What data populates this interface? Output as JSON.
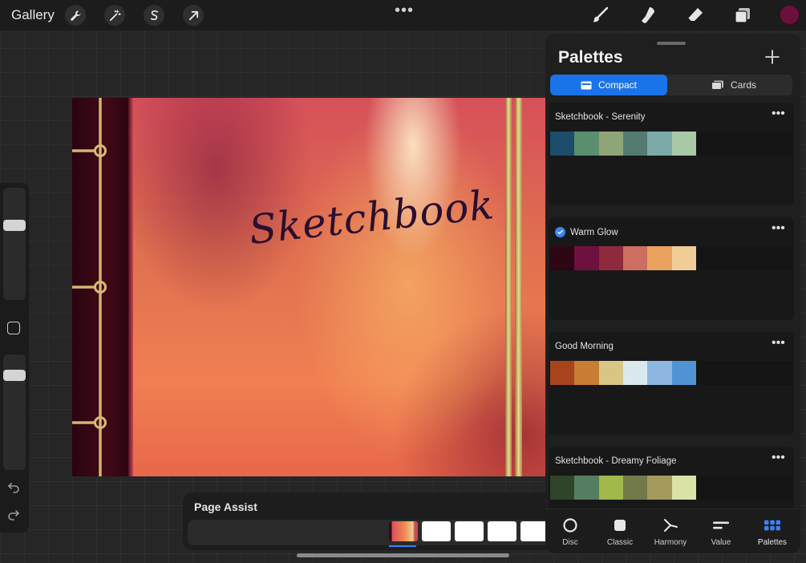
{
  "topbar": {
    "gallery_label": "Gallery",
    "tools_left": [
      "wrench-icon",
      "magic-wand-icon",
      "selection-icon",
      "transform-arrow-icon"
    ],
    "more_label": "•••",
    "tools_right": [
      "brush-icon",
      "smudge-icon",
      "eraser-icon",
      "layers-icon"
    ],
    "current_color": "#6b0f3d"
  },
  "canvas": {
    "title": "Sketchbook"
  },
  "page_assist": {
    "title": "Page Assist"
  },
  "panel": {
    "title": "Palettes",
    "view_modes": [
      {
        "label": "Compact",
        "active": true
      },
      {
        "label": "Cards",
        "active": false
      }
    ],
    "palettes": [
      {
        "name": "Sketchbook - Serenity",
        "default": false,
        "colors": [
          "#1e4c6b",
          "#5a8f6e",
          "#90a577",
          "#557a72",
          "#7aaba9",
          "#a9c8a6"
        ]
      },
      {
        "name": "Warm Glow",
        "default": true,
        "colors": [
          "#2d0614",
          "#6e1040",
          "#8e2a3c",
          "#cd6e62",
          "#e9a35e",
          "#f0cd96"
        ]
      },
      {
        "name": "Good Morning",
        "default": false,
        "colors": [
          "#a8441d",
          "#c87d33",
          "#d9c584",
          "#d9e9ee",
          "#8db7de",
          "#4f93d4"
        ]
      },
      {
        "name": "Sketchbook - Dreamy Foliage",
        "default": false,
        "colors": [
          "#2f4429",
          "#557d62",
          "#a0b94a",
          "#737a4a",
          "#a59a5c",
          "#dbe2a5"
        ]
      }
    ],
    "more_label": "•••"
  },
  "color_tabs": [
    {
      "label": "Disc",
      "icon": "disc-icon",
      "active": false
    },
    {
      "label": "Classic",
      "icon": "classic-square-icon",
      "active": false
    },
    {
      "label": "Harmony",
      "icon": "harmony-icon",
      "active": false
    },
    {
      "label": "Value",
      "icon": "value-sliders-icon",
      "active": false
    },
    {
      "label": "Palettes",
      "icon": "palettes-grid-icon",
      "active": true
    }
  ],
  "colors": {
    "accent": "#1a73e8",
    "check": "#3b82f6"
  }
}
